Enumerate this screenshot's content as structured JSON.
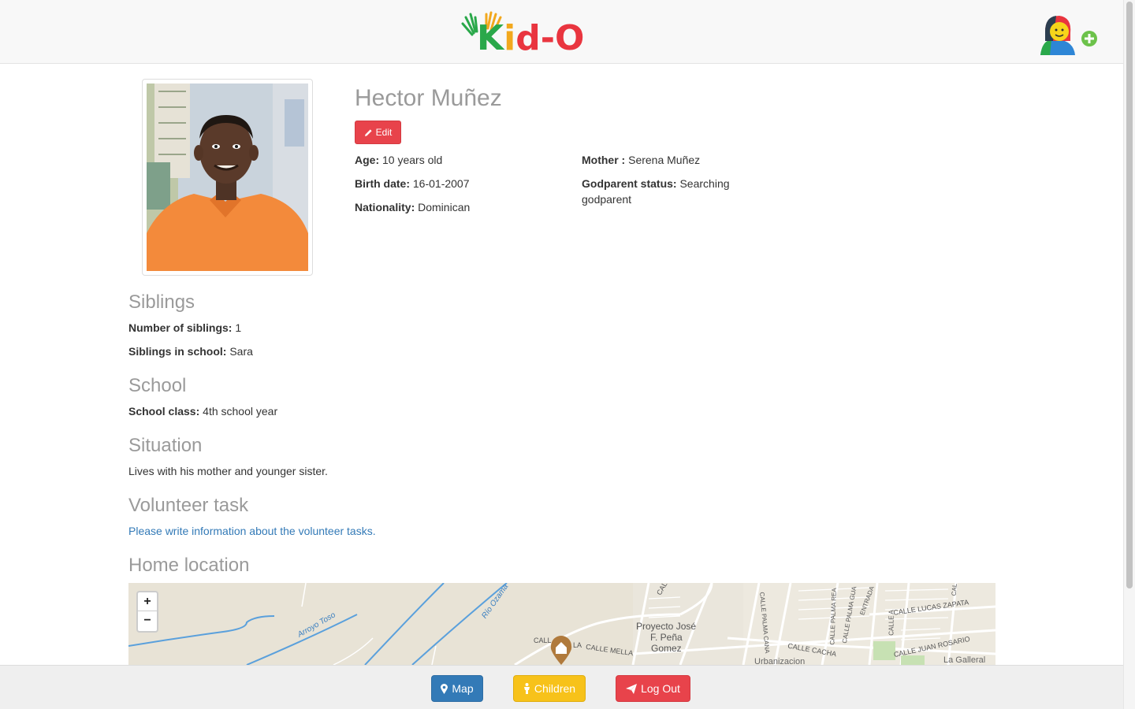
{
  "header": {
    "logo": {
      "text_k": "K",
      "text_i": "i",
      "text_d": "d",
      "text_dash": "-",
      "text_o": "O"
    },
    "add_user_icon": "add-child-icon"
  },
  "child": {
    "name": "Hector Muñez",
    "edit_label": "Edit",
    "age_label": "Age:",
    "age_value": "10 years old",
    "birth_label": "Birth date:",
    "birth_value": "16-01-2007",
    "nationality_label": "Nationality:",
    "nationality_value": "Dominican",
    "mother_label": "Mother :",
    "mother_value": "Serena Muñez",
    "godparent_label": "Godparent status:",
    "godparent_value": "Searching godparent"
  },
  "siblings": {
    "title": "Siblings",
    "count_label": "Number of siblings:",
    "count_value": "1",
    "school_label": "Siblings in school:",
    "school_value": "Sara"
  },
  "school": {
    "title": "School",
    "class_label": "School class:",
    "class_value": "4th school year"
  },
  "situation": {
    "title": "Situation",
    "text": "Lives with his mother and younger sister."
  },
  "volunteer": {
    "title": "Volunteer task",
    "link_text": "Please write information about the volunteer tasks."
  },
  "location": {
    "title": "Home location",
    "zoom_in": "+",
    "zoom_out": "−",
    "labels": {
      "arroyo": "Arroyo Toso",
      "rio": "Río Ozama",
      "proyecto1": "Proyecto José",
      "proyecto2": "F. Peña",
      "proyecto3": "Gomez",
      "calle_mella": "CALLE MELLA",
      "calle": "CALL",
      "la": "LA",
      "palma_cana": "CALLE PALMA CANA",
      "palma_rea": "CALLE PALMA REA",
      "palma_gua": "CALLE PALMA GUA",
      "entrada": "ENTRADA",
      "calle_a": "CALLE A",
      "cal": "CAL",
      "lucas": "CALLE LUCAS ZAPATA",
      "cacha": "CALLE CACHA",
      "juan": "CALLE JUAN ROSARIO",
      "urbanizacion": "Urbanizacion",
      "galleral": "La Galleral",
      "top_cal": "CAL"
    }
  },
  "footer": {
    "map_label": "Map",
    "children_label": "Children",
    "logout_label": "Log Out"
  },
  "colors": {
    "brand_red": "#e8434b",
    "brand_blue": "#337ab7",
    "brand_yellow": "#f7c21a",
    "heading_grey": "#9a9a9a"
  }
}
